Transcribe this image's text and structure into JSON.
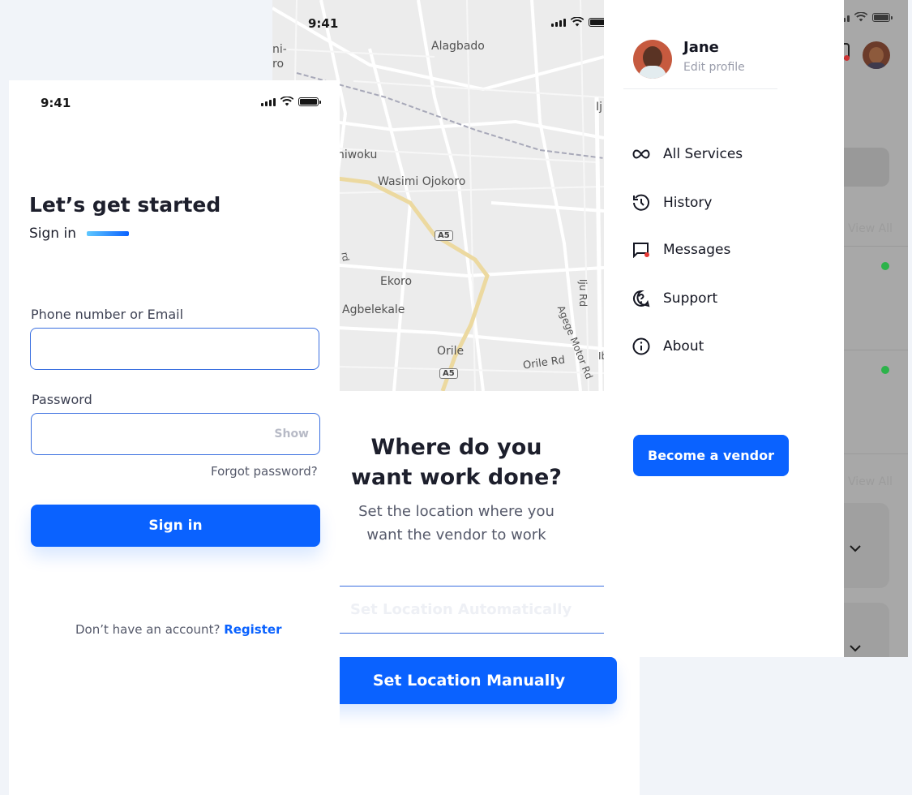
{
  "colors": {
    "primary": "#0a62ff",
    "online": "#2cb34a",
    "badge": "#e53935"
  },
  "status_bar": {
    "time": "9:41"
  },
  "signin": {
    "title": "Let’s get started",
    "subtitle": "Sign in",
    "phone_label": "Phone number or Email",
    "phone_value": "",
    "password_label": "Password",
    "password_value": "",
    "show_toggle": "Show",
    "forgot": "Forgot password?",
    "signin_button": "Sign in",
    "no_account": "Don’t have an account?",
    "register": "Register"
  },
  "location": {
    "map_labels": {
      "alagbado": "Alagbado",
      "ni": "ni-",
      "ro": "ro",
      "ij": "Ij",
      "iwoku": "niwoku",
      "wasimi": "Wasimi Ojokoro",
      "a5_1": "A5",
      "rd": "rd",
      "ekoro": "Ekoro",
      "agbelekale": "Agbelekale",
      "ijurd": "Iju Rd",
      "agege": "Agege Motor Rd",
      "orile": "Orile",
      "orilerd": "Orile Rd",
      "ib": "Ib",
      "a5_2": "A5"
    },
    "heading_line1": "Where do you",
    "heading_line2": "want work done?",
    "sub_line1": "Set the location where you",
    "sub_line2": "want the vendor to work",
    "auto_button": "Set Location Automatically",
    "manual_button": "Set Location Manually"
  },
  "menu": {
    "user_name": "Jane",
    "edit_profile": "Edit profile",
    "items": [
      {
        "label": "All Services",
        "icon": "infinity-icon"
      },
      {
        "label": "History",
        "icon": "history-icon"
      },
      {
        "label": "Messages",
        "icon": "messages-icon"
      },
      {
        "label": "Support",
        "icon": "support-icon"
      },
      {
        "label": "About",
        "icon": "info-icon"
      }
    ],
    "vendor_button": "Become a vendor"
  },
  "home": {
    "view_all_1": "View All",
    "view_all_2": "View All"
  }
}
